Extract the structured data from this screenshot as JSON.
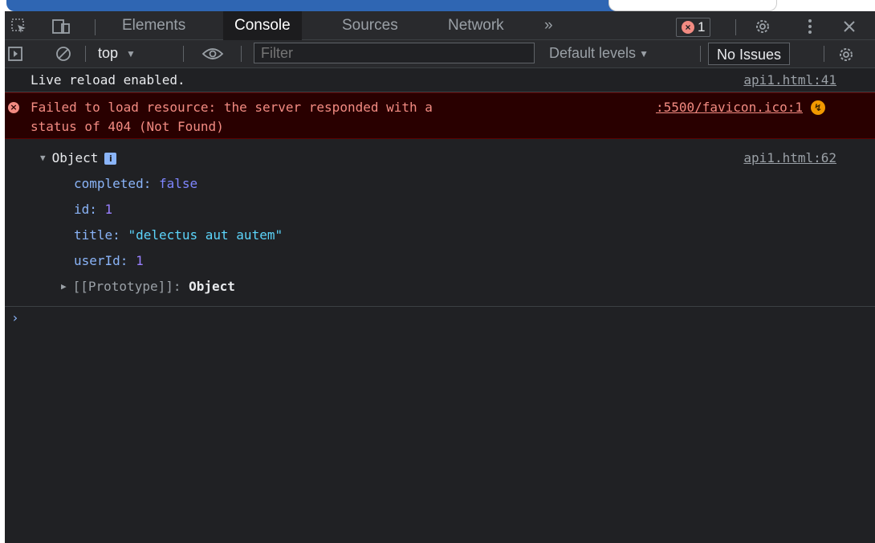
{
  "toolbar": {
    "tabs": [
      "Elements",
      "Console",
      "Sources",
      "Network"
    ],
    "more_tabs": "»",
    "error_count": "1",
    "icons": [
      "inspect-icon",
      "device-toggle-icon",
      "gear-icon",
      "more-vertical-icon",
      "close-icon"
    ]
  },
  "filter_bar": {
    "context": "top",
    "filter_placeholder": "Filter",
    "levels": "Default levels",
    "issues": "No Issues"
  },
  "console": {
    "log1": {
      "text": "Live reload enabled.",
      "source": "api1.html:41"
    },
    "error": {
      "line1": "Failed to load resource: the server responded with a",
      "line2": "status of 404 (Not Found)",
      "source": ":5500/favicon.ico:1"
    },
    "object": {
      "label": "Object",
      "source": "api1.html:62",
      "props": [
        {
          "key": "completed",
          "value": "false",
          "type": "bool"
        },
        {
          "key": "id",
          "value": "1",
          "type": "num"
        },
        {
          "key": "title",
          "value": "\"delectus aut autem\"",
          "type": "str"
        },
        {
          "key": "userId",
          "value": "1",
          "type": "num"
        }
      ],
      "proto_key": "[[Prototype]]",
      "proto_value": "Object"
    },
    "prompt": "›"
  },
  "colors": {
    "error_bg": "#290000",
    "error_text": "#f28b82",
    "accent": "#8ab4f8"
  }
}
